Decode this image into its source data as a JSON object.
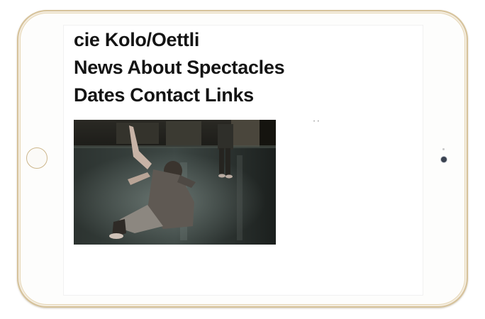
{
  "site": {
    "title": "cie Kolo/Oettli"
  },
  "nav": {
    "news": "News",
    "about": "About",
    "spectacles": "Spectacles",
    "dates": "Dates",
    "contact": "Contact",
    "links": "Links"
  },
  "slideshow": {
    "indicator": "• •"
  },
  "colors": {
    "frame_gold": "#d6c29a",
    "text": "#141414",
    "screen_bg": "#ffffff"
  },
  "icons": {
    "home_button": "home-button-icon",
    "camera": "front-camera-icon"
  }
}
